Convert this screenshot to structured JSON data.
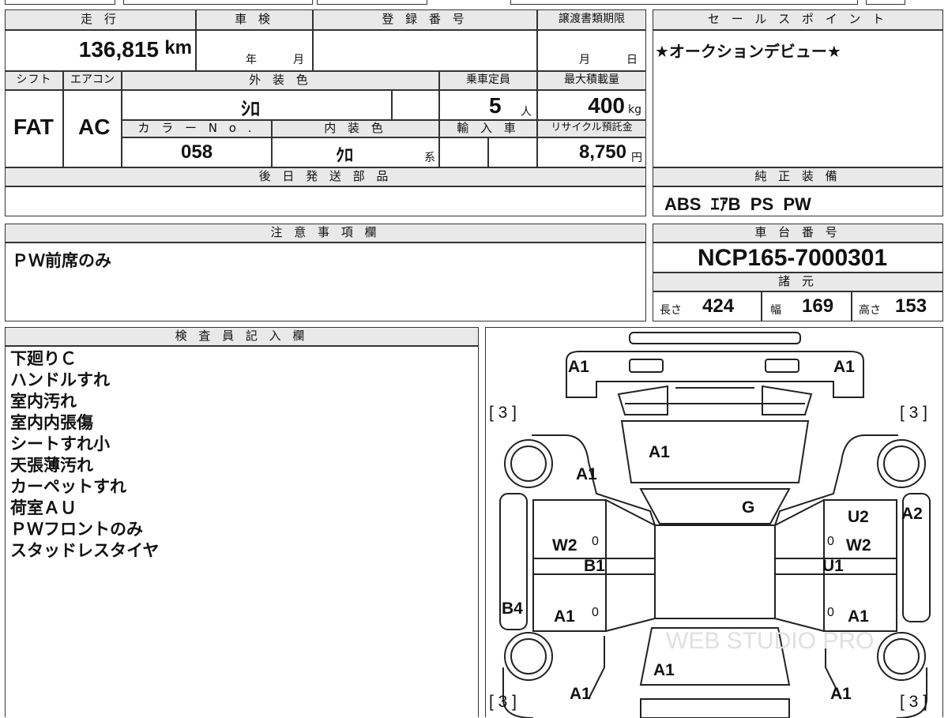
{
  "headers": {
    "mileage": "走 行",
    "inspection": "車 検",
    "registration": "登 録 番 号",
    "transfer_deadline": "譲渡書類期限",
    "sales_point": "セ ー ル ス ポ イ ン ト",
    "shift": "シフト",
    "aircon": "エアコン",
    "exterior_color": "外 装 色",
    "capacity": "乗車定員",
    "max_load": "最大積載量",
    "color_no": "カ ラ ー N o .",
    "interior_color": "内 装 色",
    "import": "輸 入 車",
    "recycle": "リサイクル預託金",
    "later_parts": "後 日 発 送 部 品",
    "genuine_equipment": "純 正 装 備",
    "notes": "注 意 事 項 欄",
    "chassis": "車 台 番 号",
    "specs": "諸 元",
    "inspector": "検 査 員 記 入 欄"
  },
  "values": {
    "mileage": "136,815",
    "mileage_unit": "km",
    "inspection_year": "年",
    "inspection_month": "月",
    "transfer_month": "月",
    "transfer_day": "日",
    "sales_point": "★オークションデビュー★",
    "shift": "FAT",
    "aircon": "AC",
    "exterior_color": "ｼﾛ",
    "capacity": "5",
    "capacity_unit": "人",
    "max_load": "400",
    "max_load_unit": "kg",
    "color_no": "058",
    "interior_color": "ｸﾛ",
    "interior_suffix": "系",
    "recycle": "8,750",
    "recycle_unit": "円",
    "genuine_equipment": "ABS  ｴｱB  PS  PW",
    "notes": "ＰＷ前席のみ",
    "chassis": "NCP165-7000301",
    "length_label": "長さ",
    "length": "424",
    "width_label": "幅",
    "width": "169",
    "height_label": "高さ",
    "height": "153"
  },
  "inspector_notes": [
    "下廻りＣ",
    "ハンドルすれ",
    "室内汚れ",
    "室内内張傷",
    "シートすれ小",
    "天張薄汚れ",
    "カーペットすれ",
    "荷室ＡＵ",
    "ＰＷフロントのみ",
    "スタッドレスタイヤ"
  ],
  "diagram_marks": {
    "front_left": "A1",
    "front_right": "A1",
    "tire_fl": "[ 3 ]",
    "tire_fr": "[ 3 ]",
    "tire_rl": "[ 3 ]",
    "tire_rr": "[ 3 ]",
    "hood": "A1",
    "left_fender": "A1",
    "windshield": "G",
    "right_front_door_upper": "U2",
    "right_fender": "A2",
    "left_front_door": "W2",
    "left_front_door_zero": "0",
    "right_front_door": "W2",
    "right_front_door_zero": "0",
    "left_pillar": "B1",
    "right_pillar": "U1",
    "left_rocker": "B4",
    "left_rear_door": "A1",
    "left_rear_door_zero": "0",
    "right_rear_door": "A1",
    "right_rear_door_zero": "0",
    "rear_glass": "A1",
    "rear_left": "A1",
    "rear_right": "A1",
    "watermark": "WEB STUDIO PRO"
  }
}
